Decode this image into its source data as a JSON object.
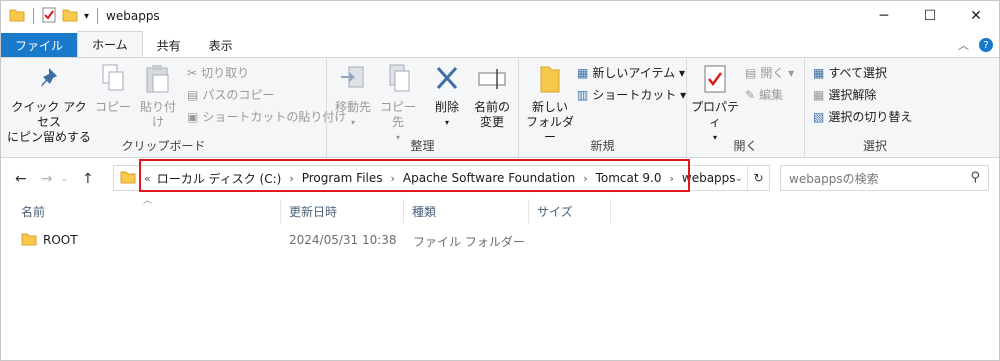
{
  "titlebar": {
    "title": "webapps",
    "minimize": "─",
    "maximize": "☐",
    "close": "✕"
  },
  "menubar": {
    "tabs": [
      "ファイル",
      "ホーム",
      "共有",
      "表示"
    ],
    "collapse": "︿",
    "help": "?"
  },
  "ribbon": {
    "clipboard": {
      "label": "クリップボード",
      "pin": "クイック アクセス\nにピン留めする",
      "copy": "コピー",
      "paste": "貼り付け",
      "cut": "切り取り",
      "copy_path": "パスのコピー",
      "paste_shortcut": "ショートカットの貼り付け"
    },
    "organize": {
      "label": "整理",
      "move_to": "移動先",
      "copy_to": "コピー先",
      "delete": "削除",
      "rename": "名前の\n変更"
    },
    "new": {
      "label": "新規",
      "new_folder": "新しい\nフォルダー",
      "new_item": "新しいアイテム ▾",
      "easy_access": "ショートカット ▾"
    },
    "open": {
      "label": "開く",
      "properties": "プロパティ",
      "open": "開く ▾",
      "edit": "編集"
    },
    "select": {
      "label": "選択",
      "select_all": "すべて選択",
      "select_none": "選択解除",
      "invert": "選択の切り替え"
    }
  },
  "address": {
    "crumbs": [
      "ローカル ディスク (C:)",
      "Program Files",
      "Apache Software Foundation",
      "Tomcat 9.0",
      "webapps"
    ],
    "search_placeholder": "webappsの検索"
  },
  "columns": [
    "名前",
    "更新日時",
    "種類",
    "サイズ"
  ],
  "files": [
    {
      "name": "ROOT",
      "modified": "2024/05/31 10:38",
      "type": "ファイル フォルダー",
      "size": ""
    }
  ],
  "colors": {
    "accent": "#1979ca",
    "highlight": "#e0191d",
    "folder": "#f7c84a"
  }
}
